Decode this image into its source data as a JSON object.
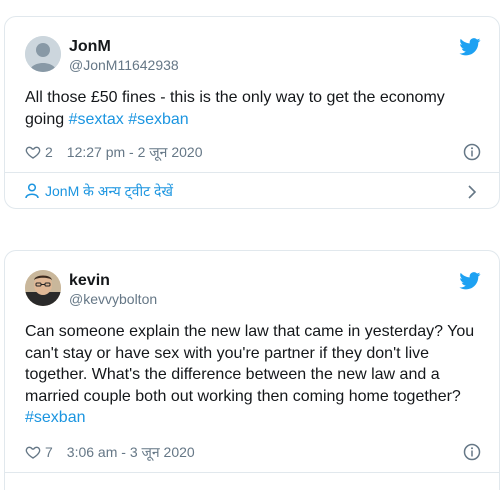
{
  "tweets": [
    {
      "name": "JonM",
      "handle": "@JonM11642938",
      "text_plain": "All those £50 fines - this is the only way to get the economy going ",
      "hashtags": [
        "#sextax",
        "#sexban"
      ],
      "likes": "2",
      "timestamp": "12:27 pm - 2 जून 2020",
      "more_link": "JonM के अन्य ट्वीट देखें"
    },
    {
      "name": "kevin",
      "handle": "@kevvybolton",
      "text_plain": "Can someone explain the new law that came in yesterday? You can't stay or have sex with you're partner if they don't live together. What's the difference between the new law and a married couple both out working then coming home together? ",
      "hashtags": [
        "#sexban"
      ],
      "likes": "7",
      "timestamp": "3:06 am - 3 जून 2020"
    }
  ],
  "icons": {
    "bird": "twitter-bird-icon",
    "heart": "heart-icon",
    "info": "info-icon",
    "person": "person-icon",
    "chevron": "chevron-right-icon"
  },
  "colors": {
    "accent": "#1b95e0",
    "bird": "#1da1f2",
    "muted": "#657786",
    "border": "#e1e8ed"
  }
}
